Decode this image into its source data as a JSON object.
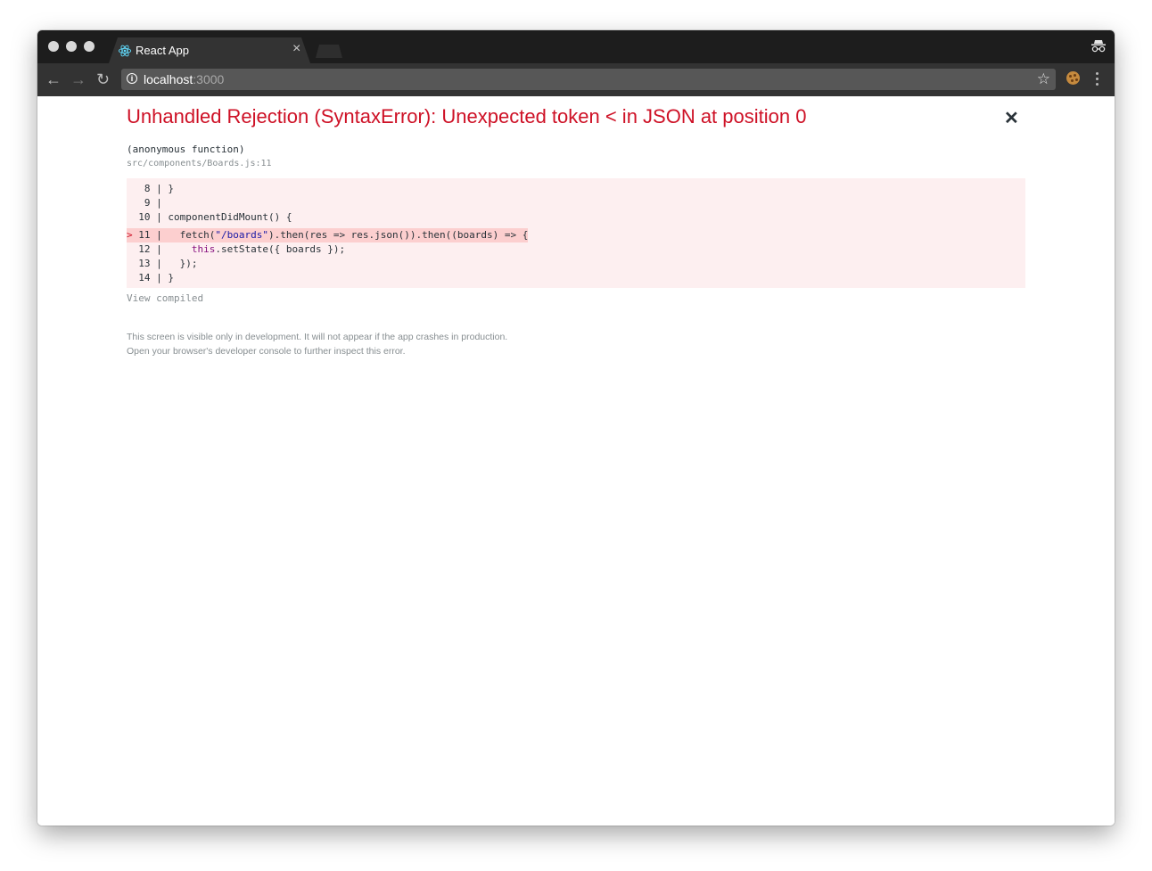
{
  "browser": {
    "tab_title": "React App",
    "tab_icon": "react-logo-icon",
    "url_host": "localhost",
    "url_port": ":3000",
    "nav_icons": [
      "back-arrow-icon",
      "forward-arrow-icon",
      "reload-icon"
    ],
    "close_glyph": "×",
    "back_glyph": "←",
    "forward_glyph": "→",
    "reload_glyph": "↻",
    "info_glyph": "i",
    "star_glyph": "☆"
  },
  "error_overlay": {
    "title": "Unhandled Rejection (SyntaxError): Unexpected token < in JSON at position 0",
    "close_glyph": "✕",
    "function_name": "(anonymous function)",
    "location": "src/components/Boards.js:11",
    "code_lines": [
      {
        "number": "8",
        "text": "}"
      },
      {
        "number": "9",
        "text": ""
      },
      {
        "number": "10",
        "text": "componentDidMount() {"
      },
      {
        "number": "11",
        "text": "  fetch(\"/boards\").then(res => res.json()).then((boards) => {",
        "highlighted": true
      },
      {
        "number": "12",
        "text": "    this.setState({ boards });"
      },
      {
        "number": "13",
        "text": "  });"
      },
      {
        "number": "14",
        "text": "}"
      }
    ],
    "view_compiled": "View compiled",
    "footer_line1": "This screen is visible only in development. It will not appear if the app crashes in production.",
    "footer_line2": "Open your browser's developer console to further inspect this error."
  },
  "colors": {
    "error_red": "#ce1126",
    "code_bg": "#fdeff0",
    "highlight_bg": "#fccfcf"
  }
}
